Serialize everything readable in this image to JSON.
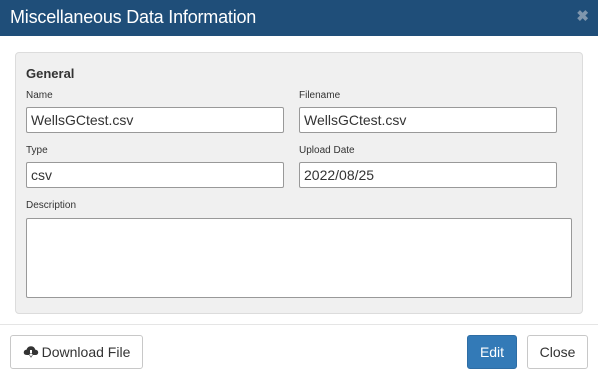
{
  "dialog": {
    "title": "Miscellaneous Data Information",
    "close_glyph": "✖"
  },
  "general": {
    "section_title": "General",
    "name": {
      "label": "Name",
      "value": "WellsGCtest.csv"
    },
    "filename": {
      "label": "Filename",
      "value": "WellsGCtest.csv"
    },
    "type": {
      "label": "Type",
      "value": "csv"
    },
    "upload_date": {
      "label": "Upload Date",
      "value": "2022/08/25"
    },
    "description": {
      "label": "Description",
      "value": ""
    }
  },
  "footer": {
    "download_label": "Download File",
    "download_icon": "cloud-download-icon",
    "edit_label": "Edit",
    "close_label": "Close"
  },
  "colors": {
    "titlebar": "#1f4e79",
    "primary_button": "#337ab7",
    "panel_bg": "#f0f0f0"
  }
}
